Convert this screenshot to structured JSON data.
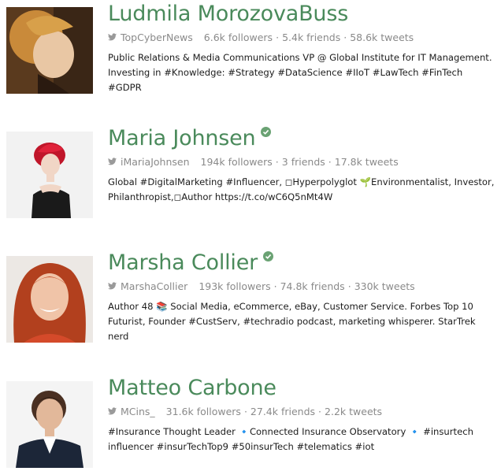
{
  "colors": {
    "name": "#4a8a5b",
    "meta": "#8a8a8a",
    "bio": "#1c1c1c",
    "verified": "#6aa273"
  },
  "profiles": [
    {
      "name": "Ludmila MorozovaBuss",
      "verified": false,
      "handle": "TopCyberNews",
      "followers": "6.6k followers",
      "friends": "5.4k friends",
      "tweets": "58.6k tweets",
      "bio": "Public Relations & Media Communications VP @ Global Institute for IT Management. Investing in #Knowledge: #Strategy #DataScience #IIoT #LawTech #FinTech #GDPR"
    },
    {
      "name": "Maria Johnsen",
      "verified": true,
      "handle": "iMariaJohnsen",
      "followers": "194k followers",
      "friends": "3 friends",
      "tweets": "17.8k tweets",
      "bio": "Global #DigitalMarketing #Influencer, ◻Hyperpolyglot 🌱Environmentalist, Investor, Philanthropist,◻Author https://t.co/wC6Q5nMt4W"
    },
    {
      "name": "Marsha Collier",
      "verified": true,
      "handle": "MarshaCollier",
      "followers": "193k followers",
      "friends": "74.8k friends",
      "tweets": "330k tweets",
      "bio": "Author 48 📚 Social Media, eCommerce, eBay, Customer Service. Forbes Top 10 Futurist, Founder #CustServ, #techradio podcast, marketing whisperer. StarTrek nerd"
    },
    {
      "name": "Matteo Carbone",
      "verified": false,
      "handle": "MCins_",
      "followers": "31.6k followers",
      "friends": "27.4k friends",
      "tweets": "2.2k tweets",
      "bio": "#Insurance Thought Leader 🔹Connected Insurance Observatory 🔹 #insurtech influencer #insurTechTop9 #50insurTech #telematics #iot"
    }
  ]
}
